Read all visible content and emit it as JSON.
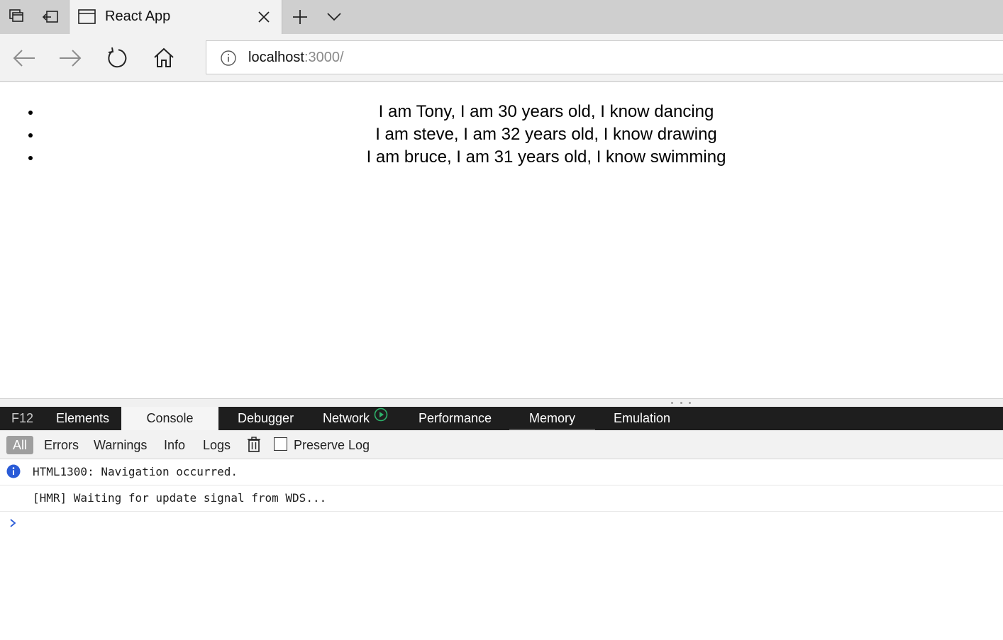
{
  "browser": {
    "tab_title": "React App",
    "address": {
      "host": "localhost",
      "rest": ":3000/"
    }
  },
  "page": {
    "items": [
      "I am Tony, I am 30 years old, I know dancing",
      "I am steve, I am 32 years old, I know drawing",
      "I am bruce, I am 31 years old, I know swimming"
    ]
  },
  "devtools": {
    "f12_label": "F12",
    "tabs": [
      "Elements",
      "Console",
      "Debugger",
      "Network",
      "Performance",
      "Memory",
      "Emulation"
    ],
    "active_tab": "Console",
    "filters": [
      "All",
      "Errors",
      "Warnings",
      "Info",
      "Logs"
    ],
    "preserve_log_label": "Preserve Log",
    "messages": [
      {
        "icon": "info-icon",
        "text": "HTML1300: Navigation occurred."
      },
      {
        "icon": "",
        "text": "[HMR] Waiting for update signal from WDS..."
      }
    ],
    "accent_color": "#2a5bd7",
    "network_indicator_color": "#2db36b"
  }
}
